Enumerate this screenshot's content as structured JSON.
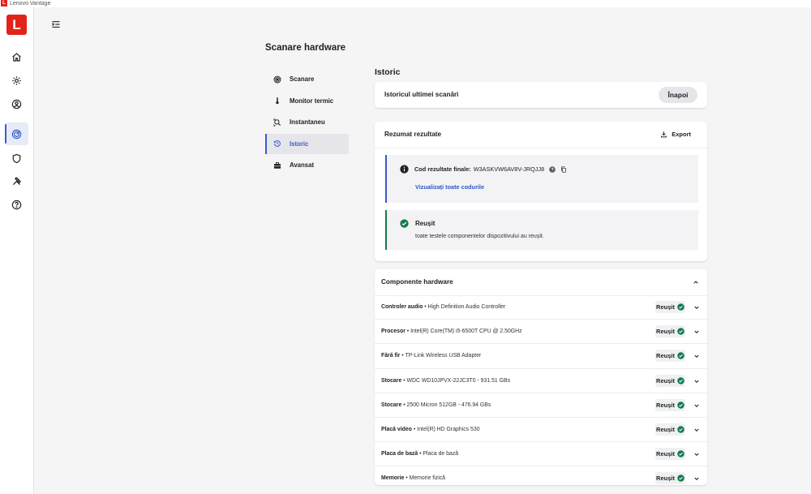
{
  "window": {
    "title": "Lenovo Vantage"
  },
  "brand": {
    "letter": "L"
  },
  "rail": {
    "items": [
      {
        "icon": "home-icon"
      },
      {
        "icon": "gear-icon"
      },
      {
        "icon": "account-icon"
      },
      {
        "icon": "hardware-scan-icon",
        "active": true
      },
      {
        "icon": "shield-icon"
      },
      {
        "icon": "tools-icon"
      },
      {
        "icon": "help-icon"
      }
    ]
  },
  "page": {
    "title": "Scanare hardware"
  },
  "subnav": {
    "items": [
      {
        "label": "Scanare",
        "icon": "target-icon"
      },
      {
        "label": "Monitor termic",
        "icon": "thermometer-icon"
      },
      {
        "label": "Instantaneu",
        "icon": "snapshot-icon"
      },
      {
        "label": "Istoric",
        "icon": "history-icon",
        "active": true
      },
      {
        "label": "Avansat",
        "icon": "toolbox-icon"
      }
    ]
  },
  "history": {
    "section_title": "Istoric",
    "card_label": "Istoricul ultimei scanări",
    "back_label": "Înapoi"
  },
  "results": {
    "title": "Rezumat rezultate",
    "export_label": "Export",
    "code_label": "Cod rezultate finale:",
    "code_value": "W3ASKVW6AV8V-JRQJJ8",
    "view_codes_link": "Vizualizați toate codurile",
    "success_title": "Reușit",
    "success_desc": "toate testele componentelor dispozitivului au reușit."
  },
  "components": {
    "title": "Componente hardware",
    "rows": [
      {
        "type": "Controler audio",
        "name": "High Definition Audio Controller",
        "status": "Reușit"
      },
      {
        "type": "Procesor",
        "name": "Intel(R) Core(TM) i5-6500T CPU @ 2.50GHz",
        "status": "Reușit"
      },
      {
        "type": "Fără fir",
        "name": "TP-Link Wireless USB Adapter",
        "status": "Reușit"
      },
      {
        "type": "Stocare",
        "name": "WDC WD10JPVX-22JC3T0 - 931.51 GBs",
        "status": "Reușit"
      },
      {
        "type": "Stocare",
        "name": "2500 Micron 512GB - 476.94 GBs",
        "status": "Reușit"
      },
      {
        "type": "Placă video",
        "name": "Intel(R) HD Graphics 530",
        "status": "Reușit"
      },
      {
        "type": "Placa de bază",
        "name": "Placa de bază",
        "status": "Reușit"
      },
      {
        "type": "Memorie",
        "name": "Memorie fizică",
        "status": "Reușit"
      }
    ]
  },
  "colors": {
    "brand": "#e2231a",
    "accent": "#3a5bc7",
    "success": "#147a4a"
  }
}
